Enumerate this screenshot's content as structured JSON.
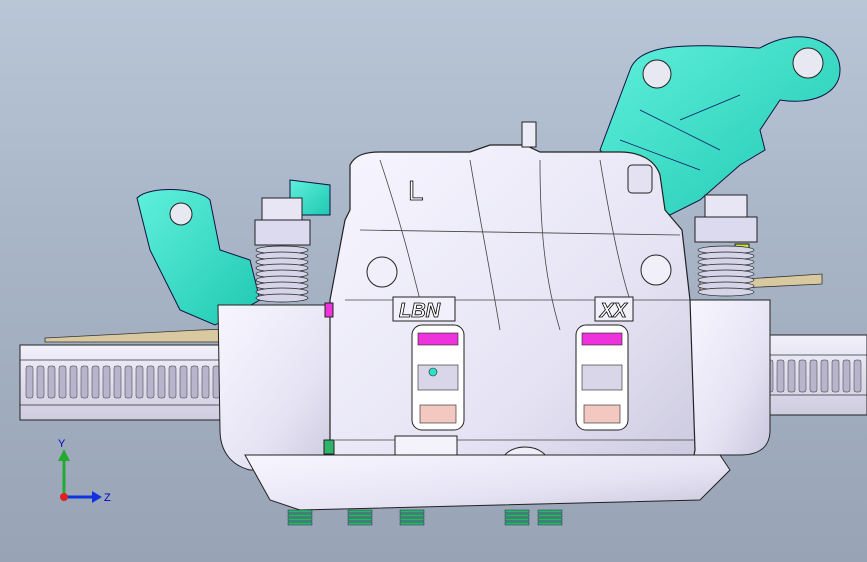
{
  "viewport": {
    "background_top": "#b9c6d6",
    "background_bottom": "#98a4b6"
  },
  "model": {
    "engraving_side": "L",
    "engraving_brand": "LBN",
    "engraving_code": "XX",
    "colors": {
      "caliper_body": "#e9e8f7",
      "bracket": "#2ee0c8",
      "disc": "#e2e0f0",
      "pad_highlight": "#ee33dd",
      "pad_lower": "#f3c8c0",
      "spring": "#2db36a",
      "edge_lines": "#222222"
    }
  },
  "triad": {
    "y_label": "Y",
    "z_label": "Z",
    "y_color": "#22aa33",
    "z_color": "#1133dd",
    "x_color": "#dd2222"
  }
}
